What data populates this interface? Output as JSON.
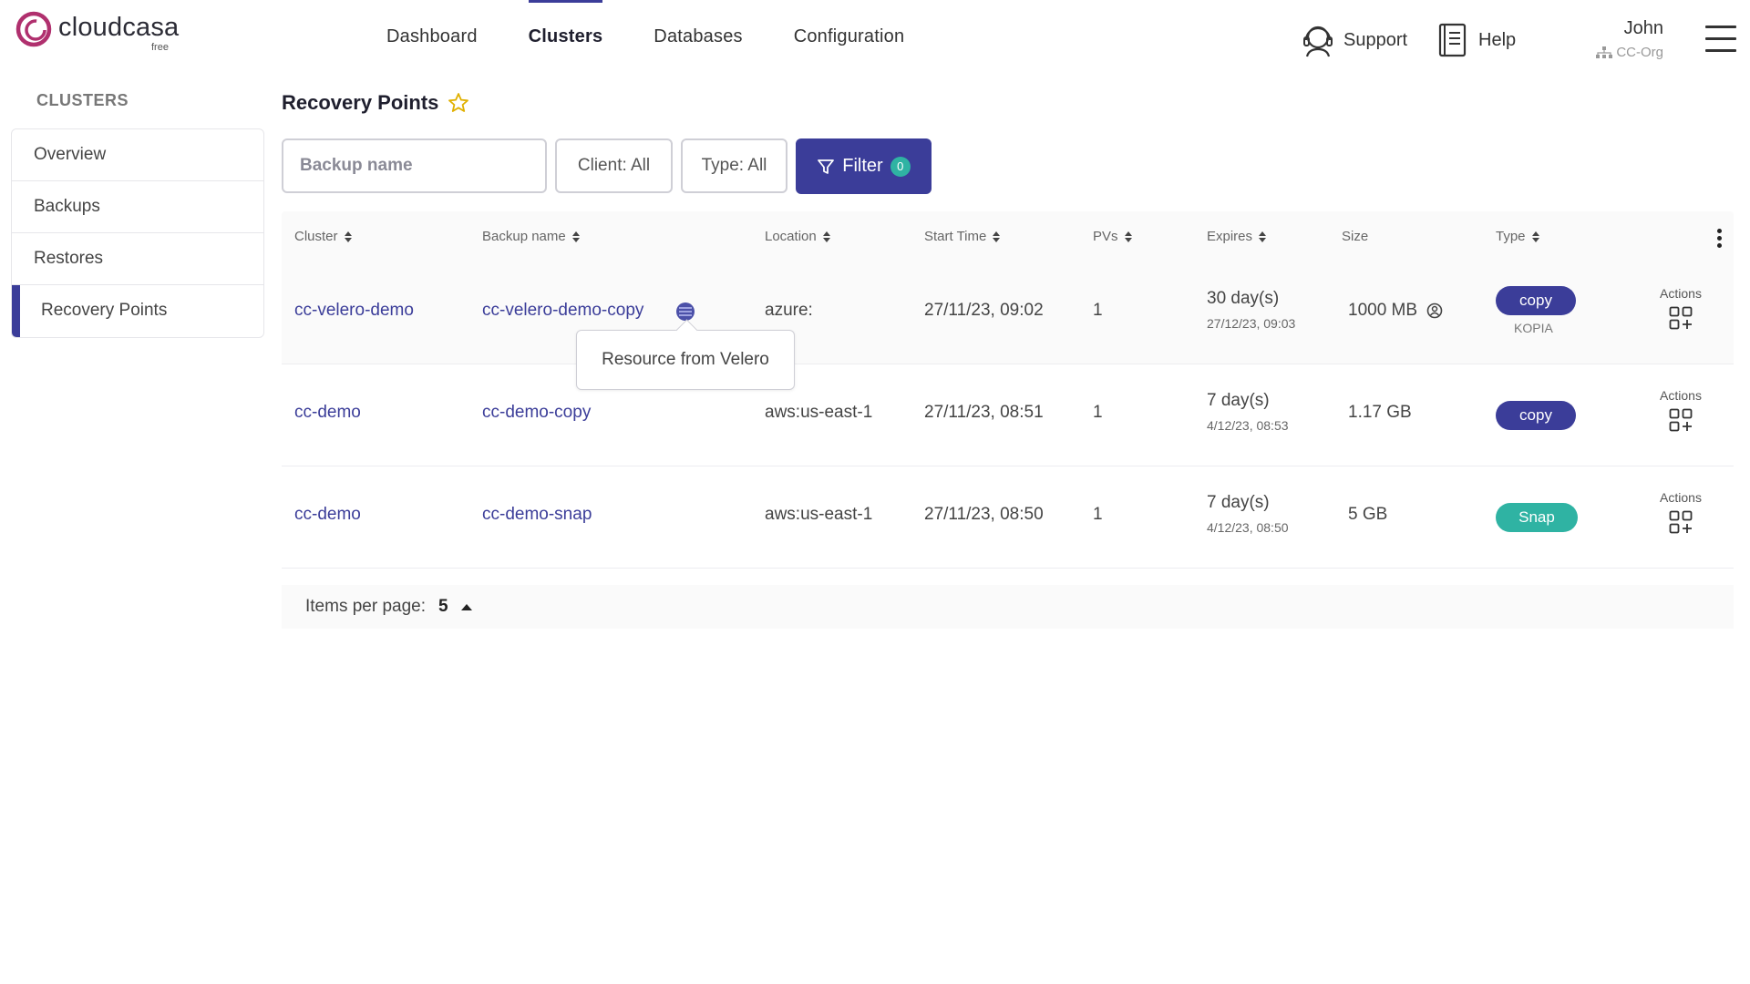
{
  "brand": {
    "name": "cloudcasa",
    "tier": "free",
    "accent": "#3b3d99",
    "ring_color": "#b0306e"
  },
  "nav": {
    "items": [
      {
        "label": "Dashboard",
        "active": false
      },
      {
        "label": "Clusters",
        "active": true
      },
      {
        "label": "Databases",
        "active": false
      },
      {
        "label": "Configuration",
        "active": false
      }
    ]
  },
  "header": {
    "support_label": "Support",
    "help_label": "Help",
    "user_name": "John",
    "org_name": "CC-Org"
  },
  "sidebar": {
    "heading": "CLUSTERS",
    "items": [
      {
        "label": "Overview",
        "active": false
      },
      {
        "label": "Backups",
        "active": false
      },
      {
        "label": "Restores",
        "active": false
      },
      {
        "label": "Recovery Points",
        "active": true
      }
    ]
  },
  "page": {
    "title": "Recovery Points",
    "favorite_icon": "star-outline-icon"
  },
  "filters": {
    "search_placeholder": "Backup name",
    "client_label": "Client: All",
    "type_label": "Type: All",
    "filter_label": "Filter",
    "filter_count": "0"
  },
  "table": {
    "columns": [
      "Cluster",
      "Backup name",
      "Location",
      "Start Time",
      "PVs",
      "Expires",
      "Size",
      "Type"
    ],
    "rows": [
      {
        "cluster": "cc-velero-demo",
        "backup": "cc-velero-demo-copy",
        "location": "azure:",
        "start": "27/11/23, 09:02",
        "pvs": "1",
        "expires": "30 day(s)",
        "expires_date": "27/12/23, 09:03",
        "size": "1000 MB",
        "type": "copy",
        "type_sub": "KOPIA",
        "actions": "Actions"
      },
      {
        "cluster": "cc-demo",
        "backup": "cc-demo-copy",
        "location": "aws:us-east-1",
        "start": "27/11/23, 08:51",
        "pvs": "1",
        "expires": "7 day(s)",
        "expires_date": "4/12/23, 08:53",
        "size": "1.17 GB",
        "type": "copy",
        "type_sub": "",
        "actions": "Actions"
      },
      {
        "cluster": "cc-demo",
        "backup": "cc-demo-snap",
        "location": "aws:us-east-1",
        "start": "27/11/23, 08:50",
        "pvs": "1",
        "expires": "7 day(s)",
        "expires_date": "4/12/23, 08:50",
        "size": "5 GB",
        "type": "Snap",
        "type_sub": "",
        "actions": "Actions"
      }
    ]
  },
  "tooltip": {
    "text": "Resource from Velero"
  },
  "pagination": {
    "label": "Items per page:",
    "value": "5"
  }
}
